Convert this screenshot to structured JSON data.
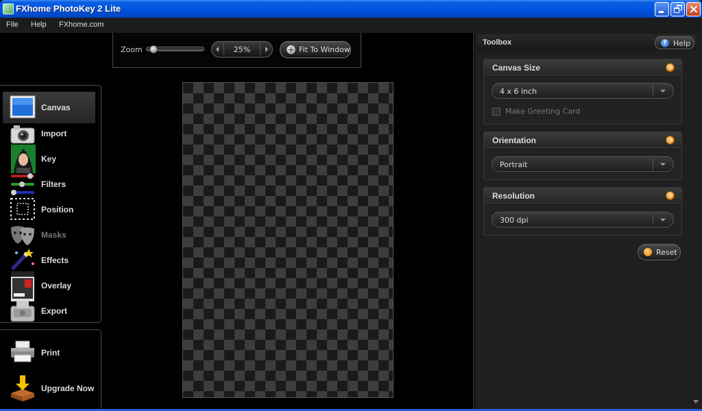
{
  "window": {
    "title": "FXhome PhotoKey 2 Lite"
  },
  "menu": {
    "file": "File",
    "help": "Help",
    "site": "FXhome.com"
  },
  "zoom": {
    "label": "Zoom",
    "value": "25%",
    "fit_label": "Fit To Window"
  },
  "nav": {
    "items": [
      {
        "label": "Canvas",
        "icon": "canvas-icon",
        "active": true
      },
      {
        "label": "Import",
        "icon": "camera-icon"
      },
      {
        "label": "Key",
        "icon": "portrait-icon"
      },
      {
        "label": "Filters",
        "icon": "sliders-icon"
      },
      {
        "label": "Position",
        "icon": "position-icon"
      },
      {
        "label": "Masks",
        "icon": "masks-icon",
        "disabled": true
      },
      {
        "label": "Effects",
        "icon": "magic-wand-icon"
      },
      {
        "label": "Overlay",
        "icon": "magazine-icon"
      },
      {
        "label": "Export",
        "icon": "export-icon"
      }
    ],
    "bottom": [
      {
        "label": "Print",
        "icon": "printer-icon"
      },
      {
        "label": "Upgrade Now",
        "icon": "upgrade-box-icon"
      }
    ]
  },
  "toolbox": {
    "title": "Toolbox",
    "help_label": "Help",
    "canvas_size": {
      "title": "Canvas Size",
      "value": "4 x 6 inch",
      "checkbox_label": "Make Greeting Card",
      "checked": false
    },
    "orientation": {
      "title": "Orientation",
      "value": "Portrait"
    },
    "resolution": {
      "title": "Resolution",
      "value": "300 dpi"
    },
    "reset_label": "Reset"
  },
  "colors": {
    "titlebar": "#0054e3",
    "accent_orange": "#e07a00",
    "panel": "#1f1f1f"
  }
}
